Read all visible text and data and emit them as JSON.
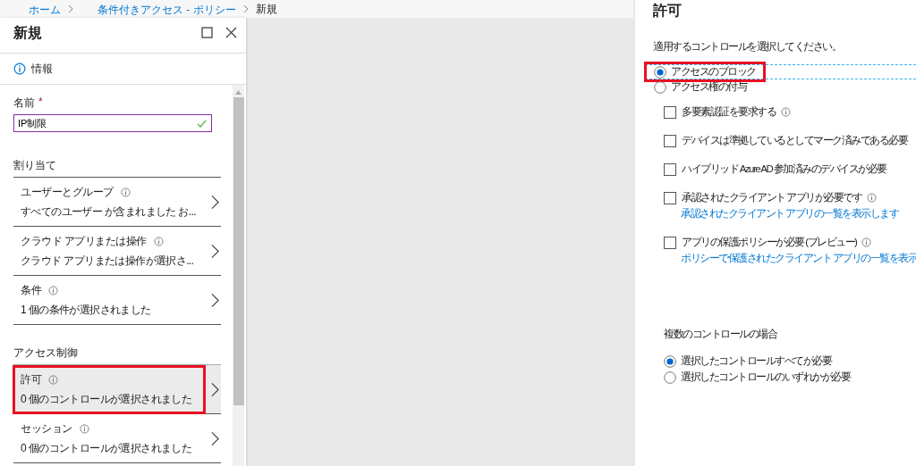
{
  "breadcrumb": [
    {
      "label": "ホーム",
      "link": true
    },
    {
      "label": "条件付きアクセス - ポリシー",
      "link": true
    },
    {
      "label": "新規",
      "link": false
    }
  ],
  "blade": {
    "title": "新規",
    "info": "情報",
    "name_field": {
      "label": "名前",
      "required_mark": "*",
      "value": "IP制限",
      "valid": true
    },
    "sections": [
      {
        "title": "割り当て",
        "items": [
          {
            "title": "ユーザーとグループ",
            "summary": "すべてのユーザー が含まれました お...",
            "selected": false,
            "highlighted": false
          },
          {
            "title": "クラウド アプリまたは操作",
            "summary": "クラウド アプリまたは操作が選択さ...",
            "selected": false,
            "highlighted": false
          },
          {
            "title": "条件",
            "summary": "1 個の条件が選択されました",
            "selected": false,
            "highlighted": false
          }
        ]
      },
      {
        "title": "アクセス制御",
        "items": [
          {
            "title": "許可",
            "summary": "0 個のコントロールが選択されました",
            "selected": true,
            "highlighted": true
          },
          {
            "title": "セッション",
            "summary": "0 個のコントロールが選択されました",
            "selected": false,
            "highlighted": false
          }
        ]
      }
    ]
  },
  "grant_panel": {
    "title": "許可",
    "prompt": "適用するコントロールを選択してください。",
    "access_options": [
      {
        "label": "アクセスのブロック",
        "selected": true,
        "highlighted": true,
        "focused": true
      },
      {
        "label": "アクセス権の付与",
        "selected": false,
        "highlighted": false,
        "focused": false
      }
    ],
    "controls": [
      {
        "label": "多要素認証を要求する",
        "checked": false,
        "info": true
      },
      {
        "label": "デバイスは準拠しているとしてマーク済みである必要",
        "checked": false,
        "info": false
      },
      {
        "label": "ハイブリッド Azure AD 参加済みのデバイスが必要",
        "checked": false,
        "info": false
      },
      {
        "label": "承認されたクライアント アプリが必要です",
        "checked": false,
        "info": true,
        "link": "承認されたクライアント アプリの一覧を表示します"
      },
      {
        "label": "アプリの保護ポリシーが必要 (プレビュー)",
        "checked": false,
        "info": true,
        "link": "ポリシーで保護されたクライアント アプリの一覧を表示"
      }
    ],
    "multi_title": "複数のコントロールの場合",
    "multi_options": [
      {
        "label": "選択したコントロールすべてが必要",
        "selected": true
      },
      {
        "label": "選択したコントロールのいずれかが必要",
        "selected": false
      }
    ]
  }
}
